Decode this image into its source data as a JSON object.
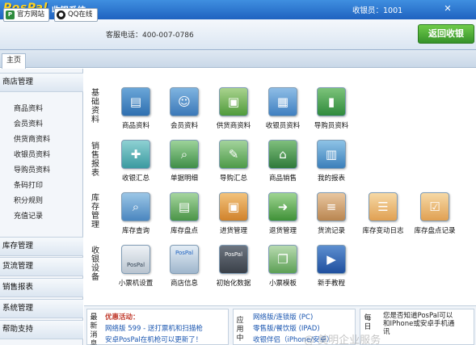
{
  "titlebar": {
    "logo": "PosPal",
    "app_title": "收银系统",
    "cashier": "收银员：1001",
    "close_label": "✕"
  },
  "toolbar": {
    "site_label": "官方网站",
    "qq_label": "QQ在线",
    "phone": "客服电话：400-007-0786",
    "back_label": "返回收银"
  },
  "tabs": {
    "home": "主页"
  },
  "sidebar": {
    "shop_head": "商店管理",
    "items": [
      "商品资料",
      "会员资料",
      "供货商资料",
      "收银员资料",
      "导购员资料",
      "条码打印",
      "积分规则",
      "充值记录"
    ],
    "inventory_head": "库存管理",
    "flow_head": "货流管理",
    "sales_head": "销售报表",
    "system_head": "系统管理",
    "help_head": "帮助支持"
  },
  "sections": {
    "basic": "基础资料",
    "sales": "销售报表",
    "stock": "库存管理",
    "device": "收银设备"
  },
  "modules": {
    "basic": [
      "商品资料",
      "会员资料",
      "供货商资料",
      "收银员资料",
      "导购员资料"
    ],
    "sales": [
      "收银汇总",
      "单据明细",
      "导购汇总",
      "商品销售",
      "我的报表"
    ],
    "stock": [
      "库存查询",
      "库存盘点",
      "进货管理",
      "退货管理",
      "货流记录",
      "库存变动日志",
      "库存盘点记录"
    ],
    "device": [
      "小票机设置",
      "商店信息",
      "初始化数据",
      "小票模板",
      "新手教程"
    ]
  },
  "icon_text": {
    "pospal_small": "PosPal",
    "pospal_box": "PosPal"
  },
  "bottom": {
    "news_side": "最新消息",
    "promo_title": "优惠活动：",
    "promo_line1": "网络版 599 - 送打票机和扫描枪",
    "promo_line2": "安卓PosPal在机枪可以更新了！",
    "apps_side": "应用中",
    "apps_line1": "网络版/连锁版 (PC)",
    "apps_line2": "零售版/餐饮版 (IPAD)",
    "apps_line3": "收银伴侣（iPhone/安卓）",
    "daily_side": "每日",
    "daily_line1": "您是否知道PosPal可以",
    "daily_line2": "和IPhone或安卓手机通",
    "daily_line3": "讯",
    "watermark": "@ 美明企业服务"
  },
  "colors": {
    "accent": "#1f62c0",
    "logo": "#ffd21e",
    "back_button": "#36922a",
    "promo_title": "#c0392b",
    "link": "#1a56b0"
  }
}
